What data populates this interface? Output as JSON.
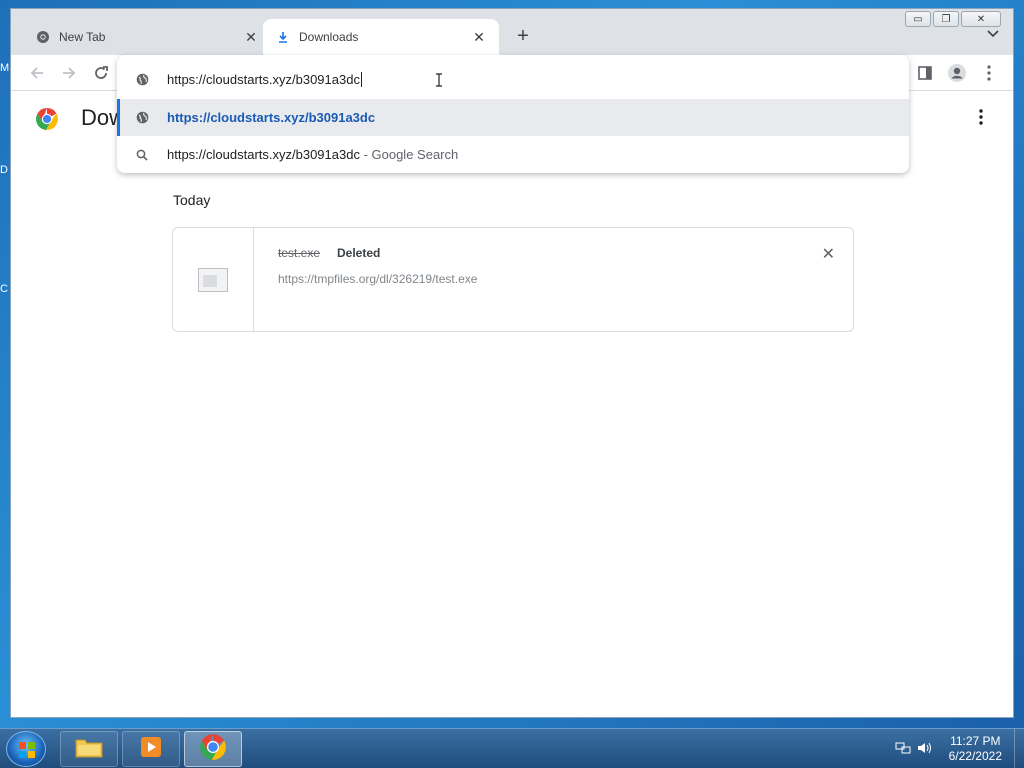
{
  "desktop": {
    "edge_letters": [
      "M",
      "D",
      "C"
    ]
  },
  "window": {
    "controls": {
      "minimize": "▭",
      "restore": "❐",
      "close": "✕"
    }
  },
  "tabs": [
    {
      "title": "New Tab",
      "icon": "chrome-icon",
      "active": false
    },
    {
      "title": "Downloads",
      "icon": "download-icon",
      "active": true
    }
  ],
  "omnibox": {
    "input_value": "https://cloudstarts.xyz/b3091a3dc",
    "suggestions": [
      {
        "text": "https://cloudstarts.xyz/b3091a3dc",
        "icon": "globe-icon",
        "selected": true
      },
      {
        "text": "https://cloudstarts.xyz/b3091a3dc",
        "suffix": " - Google Search",
        "icon": "search-icon",
        "selected": false
      }
    ]
  },
  "page": {
    "title": "Dow",
    "section": "Today",
    "downloads": [
      {
        "name": "test.exe",
        "status": "Deleted",
        "url": "https://tmpfiles.org/dl/326219/test.exe"
      }
    ]
  },
  "taskbar": {
    "apps": [
      "file-explorer",
      "media-player",
      "chrome"
    ],
    "time": "11:27 PM",
    "date": "6/22/2022"
  },
  "colors": {
    "accent": "#1a73e8",
    "selected_url": "#1a5bb5",
    "titlebar": "#dee1e6"
  }
}
